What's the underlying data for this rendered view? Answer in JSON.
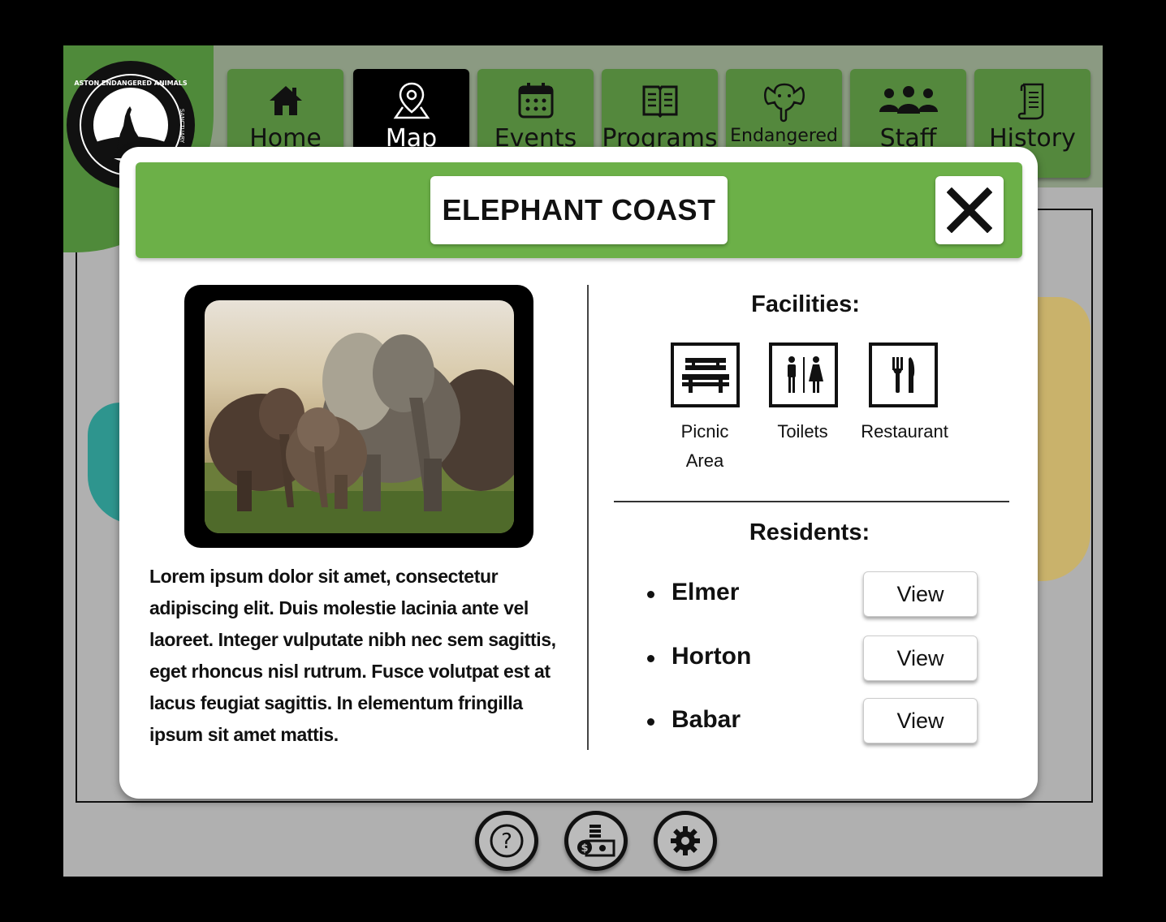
{
  "app": {
    "logo_text": "ASTON ENDANGERED ANIMALS SANCTUARY"
  },
  "nav": {
    "items": [
      {
        "label": "Home",
        "icon": "home-icon"
      },
      {
        "label": "Map",
        "icon": "map-pin-icon",
        "active": true
      },
      {
        "label": "Events",
        "icon": "calendar-icon"
      },
      {
        "label": "Programs",
        "icon": "book-icon"
      },
      {
        "label": "Endangered",
        "icon": "elephant-icon"
      },
      {
        "label": "Staff",
        "icon": "people-icon"
      },
      {
        "label": "History",
        "icon": "scroll-icon"
      }
    ]
  },
  "modal": {
    "title": "ELEPHANT COAST",
    "close_icon": "close-icon",
    "description": "Lorem ipsum dolor sit amet, consectetur adipiscing elit. Duis molestie lacinia ante vel laoreet. Integer vulputate nibh nec sem sagittis, eget rhoncus nisl rutrum. Fusce volutpat est at lacus feugiat sagittis. In elementum fringilla ipsum sit amet mattis.",
    "facilities_title": "Facilities:",
    "facilities": [
      {
        "label_line1": "Picnic",
        "label_line2": "Area",
        "icon": "picnic-bench-icon"
      },
      {
        "label_line1": "Toilets",
        "label_line2": "",
        "icon": "toilets-icon"
      },
      {
        "label_line1": "Restaurant",
        "label_line2": "",
        "icon": "restaurant-icon"
      }
    ],
    "residents_title": "Residents:",
    "residents": [
      {
        "name": "Elmer",
        "button": "View"
      },
      {
        "name": "Horton",
        "button": "View"
      },
      {
        "name": "Babar",
        "button": "View"
      }
    ]
  },
  "bottom_bar": {
    "buttons": [
      {
        "icon": "help-icon"
      },
      {
        "icon": "donate-icon"
      },
      {
        "icon": "settings-icon"
      }
    ]
  },
  "colors": {
    "accent_green": "#6cb048",
    "nav_green": "#54883d",
    "logo_green": "#4f8a3a",
    "background_gray": "#b0b0b0"
  }
}
